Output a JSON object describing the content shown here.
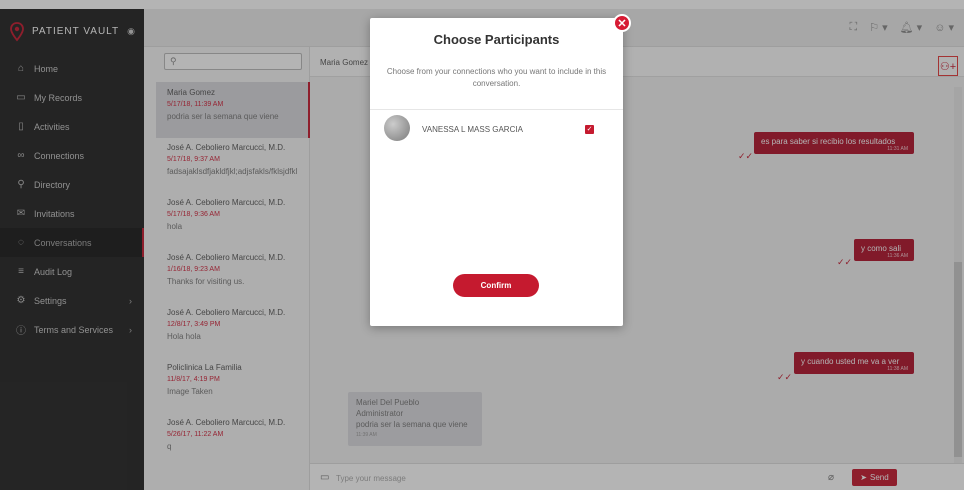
{
  "brand": {
    "name": "PATIENT VAULT"
  },
  "sidebar": {
    "items": [
      {
        "label": "Home",
        "icon": "home-icon",
        "glyph": "⌂"
      },
      {
        "label": "My Records",
        "icon": "folder-icon",
        "glyph": "▭"
      },
      {
        "label": "Activities",
        "icon": "clipboard-icon",
        "glyph": "▯"
      },
      {
        "label": "Connections",
        "icon": "connections-icon",
        "glyph": "∞"
      },
      {
        "label": "Directory",
        "icon": "search-icon",
        "glyph": "⚲"
      },
      {
        "label": "Invitations",
        "icon": "mail-icon",
        "glyph": "✉"
      },
      {
        "label": "Conversations",
        "icon": "chat-icon",
        "glyph": "◌"
      },
      {
        "label": "Audit Log",
        "icon": "list-icon",
        "glyph": "≡"
      },
      {
        "label": "Settings",
        "icon": "gear-icon",
        "glyph": "⚙"
      },
      {
        "label": "Terms and Services",
        "icon": "info-icon",
        "glyph": "ⓘ"
      }
    ]
  },
  "conversations": [
    {
      "name": "Maria Gomez",
      "time": "5/17/18, 11:39 AM",
      "message": "podria ser la semana que viene"
    },
    {
      "name": "José A. Ceboliero Marcucci, M.D.",
      "time": "5/17/18, 9:37 AM",
      "message": "fadsajaklsdfjakldfjkl;adjsfakls/fklsjdfkl"
    },
    {
      "name": "José A. Ceboliero Marcucci, M.D.",
      "time": "5/17/18, 9:36 AM",
      "message": "hola"
    },
    {
      "name": "José A. Ceboliero Marcucci, M.D.",
      "time": "1/16/18, 9:23 AM",
      "message": "Thanks for visiting us."
    },
    {
      "name": "José A. Ceboliero Marcucci, M.D.",
      "time": "12/8/17, 3:49 PM",
      "message": "Hola hola"
    },
    {
      "name": "Policlinica La Familia",
      "time": "11/8/17, 4:19 PM",
      "message": "Image Taken"
    },
    {
      "name": "José A. Ceboliero Marcucci, M.D.",
      "time": "5/26/17, 11:22 AM",
      "message": "q"
    }
  ],
  "chat": {
    "title": "Maria Gomez",
    "outgoing": [
      {
        "text": "es para saber si recibio los resultados",
        "time": "11:31 AM"
      },
      {
        "text": "y como sali",
        "time": "11:36 AM"
      },
      {
        "text": "y cuando usted me va a ver",
        "time": "11:38 AM"
      }
    ],
    "incoming_last": {
      "sender": "Mariel Del Pueblo",
      "role": "Administrator",
      "text": "podria ser la semana que viene",
      "time": "11:39 AM"
    },
    "composer_placeholder": "Type your message",
    "send_label": "Send"
  },
  "modal": {
    "title": "Choose Participants",
    "description": "Choose from your connections who you want to include in this conversation.",
    "participant": "VANESSA L MASS GARCIA",
    "confirm_label": "Confirm"
  },
  "colors": {
    "accent": "#c51a2f",
    "sidebar": "#232323"
  }
}
